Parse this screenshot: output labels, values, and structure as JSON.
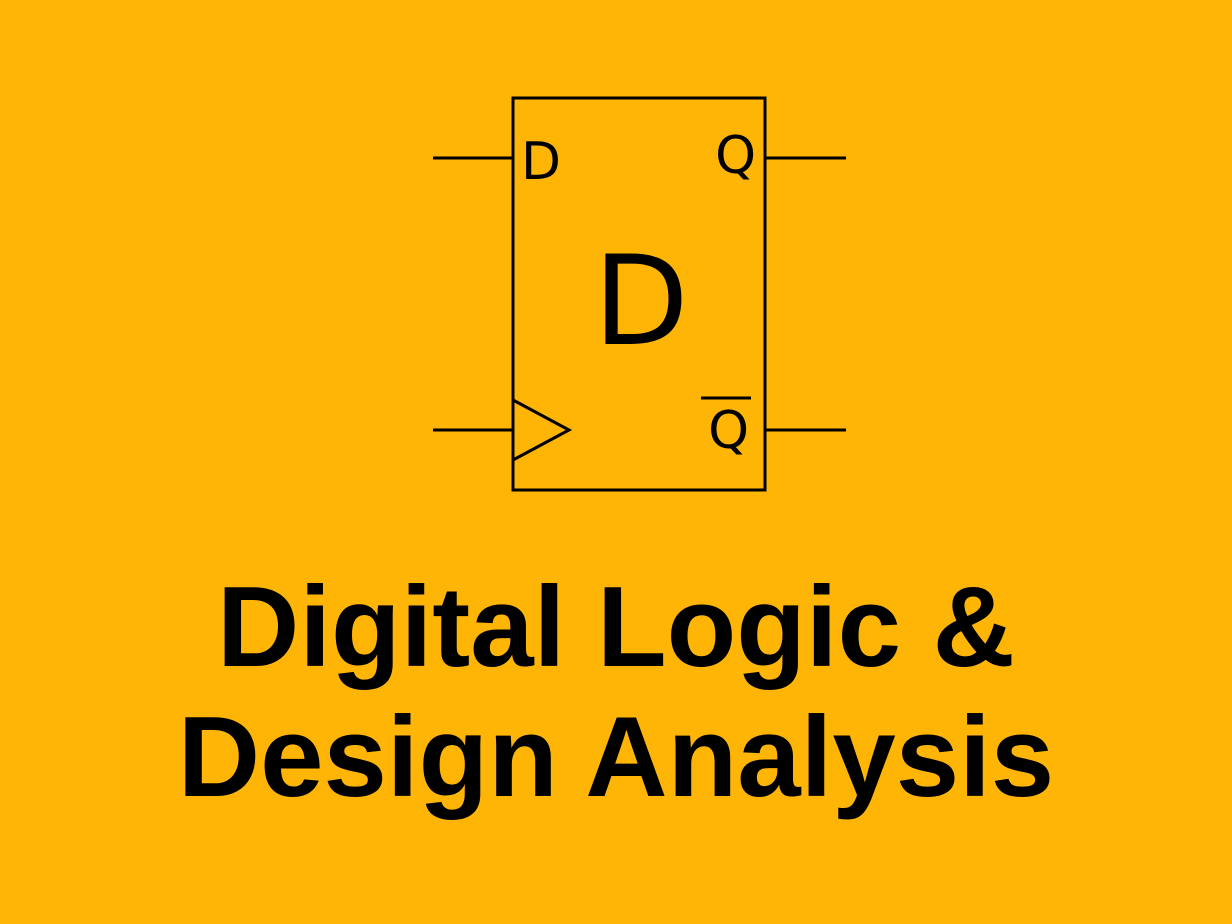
{
  "diagram": {
    "symbol": "d-flip-flop",
    "center_label": "D",
    "input_label": "D",
    "output_label": "Q",
    "inverted_output_label": "Q",
    "inverted_output_overbar": true,
    "clock_input_marker": "triangle",
    "line_color": "#000000"
  },
  "title": {
    "line1": "Digital Logic &",
    "line2": "Design Analysis"
  },
  "colors": {
    "background": "#FFB506",
    "foreground": "#000000"
  }
}
